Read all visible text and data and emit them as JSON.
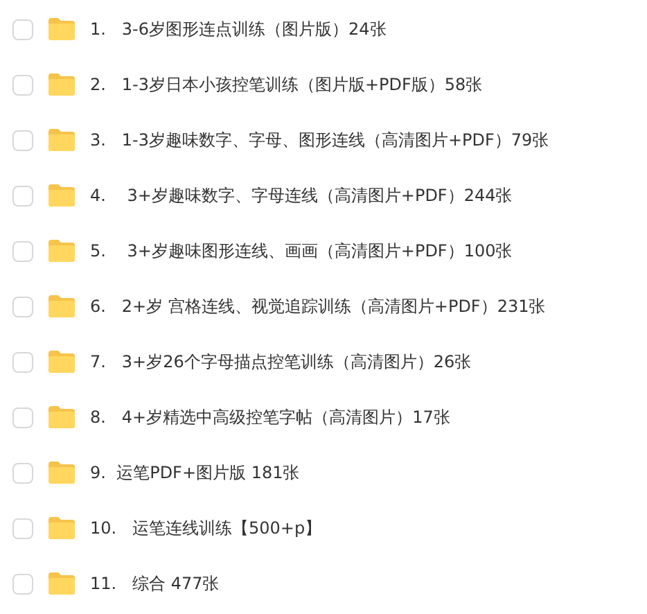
{
  "files": [
    {
      "name": "1.   3-6岁图形连点训练（图片版）24张",
      "checked": false
    },
    {
      "name": "2.   1-3岁日本小孩控笔训练（图片版+PDF版）58张",
      "checked": false
    },
    {
      "name": "3.   1-3岁趣味数字、字母、图形连线（高清图片+PDF）79张",
      "checked": false
    },
    {
      "name": "4.    3+岁趣味数字、字母连线（高清图片+PDF）244张",
      "checked": false
    },
    {
      "name": "5.    3+岁趣味图形连线、画画（高清图片+PDF）100张",
      "checked": false
    },
    {
      "name": "6.   2+岁 宫格连线、视觉追踪训练（高清图片+PDF）231张",
      "checked": false
    },
    {
      "name": "7.   3+岁26个字母描点控笔训练（高清图片）26张",
      "checked": false
    },
    {
      "name": "8.   4+岁精选中高级控笔字帖（高清图片）17张",
      "checked": false
    },
    {
      "name": "9.  运笔PDF+图片版 181张",
      "checked": false
    },
    {
      "name": "10.   运笔连线训练【500+p】",
      "checked": false
    },
    {
      "name": "11.   综合 477张",
      "checked": false
    }
  ]
}
